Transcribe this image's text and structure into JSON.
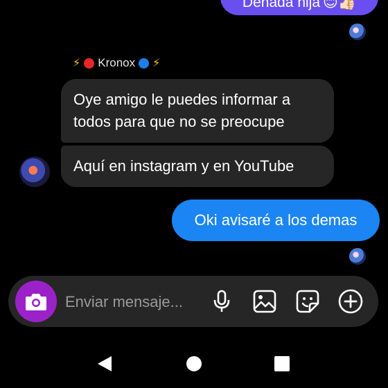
{
  "thread": {
    "top_message": "Dehada hija",
    "top_message_emoji": "😊👍🏻",
    "sender": {
      "prefix": "⚡",
      "name": "Kronox",
      "suffix": "⚡"
    },
    "incoming": [
      "Oye amigo le puedes informar a todos para que no se preocupe",
      "Aquí en instagram y en YouTube"
    ],
    "outgoing": "Oki avisaré a los demas"
  },
  "composer": {
    "placeholder": "Enviar mensaje..."
  },
  "colors": {
    "outgoing_purple": "#6a4ff0",
    "outgoing_blue": "#1b85f3",
    "incoming_bg": "#262626",
    "camera_button": "#9b22c8"
  },
  "icons": [
    "camera-icon",
    "microphone-icon",
    "image-icon",
    "sticker-icon",
    "plus-circle-icon",
    "back-icon",
    "home-icon",
    "recents-icon"
  ]
}
